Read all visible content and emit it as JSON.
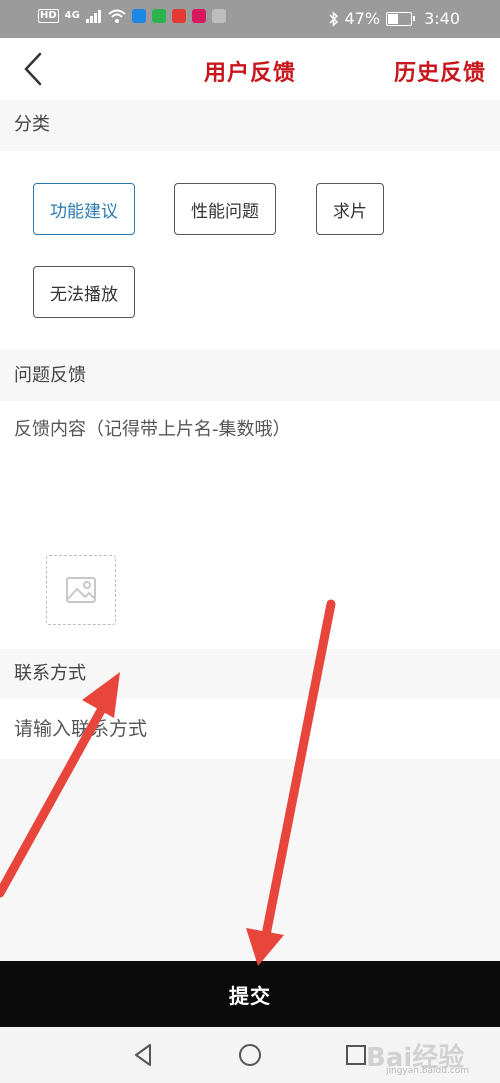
{
  "status_bar": {
    "hd": "HD",
    "network": "4G",
    "battery": "47%",
    "battery_level": 0.47,
    "time": "3:40",
    "app_icon_colors": [
      "#1e88e5",
      "#2bb24c",
      "#e53935",
      "#d81b60",
      "#9e9e9e"
    ]
  },
  "navbar": {
    "back_icon": "chevron-left-icon",
    "title": "用户反馈",
    "history": "历史反馈",
    "accent_color": "#c8161d"
  },
  "category": {
    "header": "分类",
    "chips": [
      {
        "label": "功能建议",
        "selected": true
      },
      {
        "label": "性能问题",
        "selected": false
      },
      {
        "label": "求片",
        "selected": false
      },
      {
        "label": "无法播放",
        "selected": false
      }
    ],
    "selected_color": "#2a7ab0"
  },
  "feedback": {
    "header": "问题反馈",
    "placeholder": "反馈内容（记得带上片名-集数哦）",
    "upload_icon": "image-icon"
  },
  "contact": {
    "header": "联系方式",
    "placeholder": "请输入联系方式"
  },
  "submit_label": "提交",
  "system_nav": {
    "back_icon": "triangle-back-icon",
    "home_icon": "circle-home-icon",
    "recent_icon": "square-recent-icon"
  },
  "watermark": {
    "text": "Bai经验",
    "url": "jingyan.baidu.com"
  },
  "annotation_color": "#e8453c"
}
